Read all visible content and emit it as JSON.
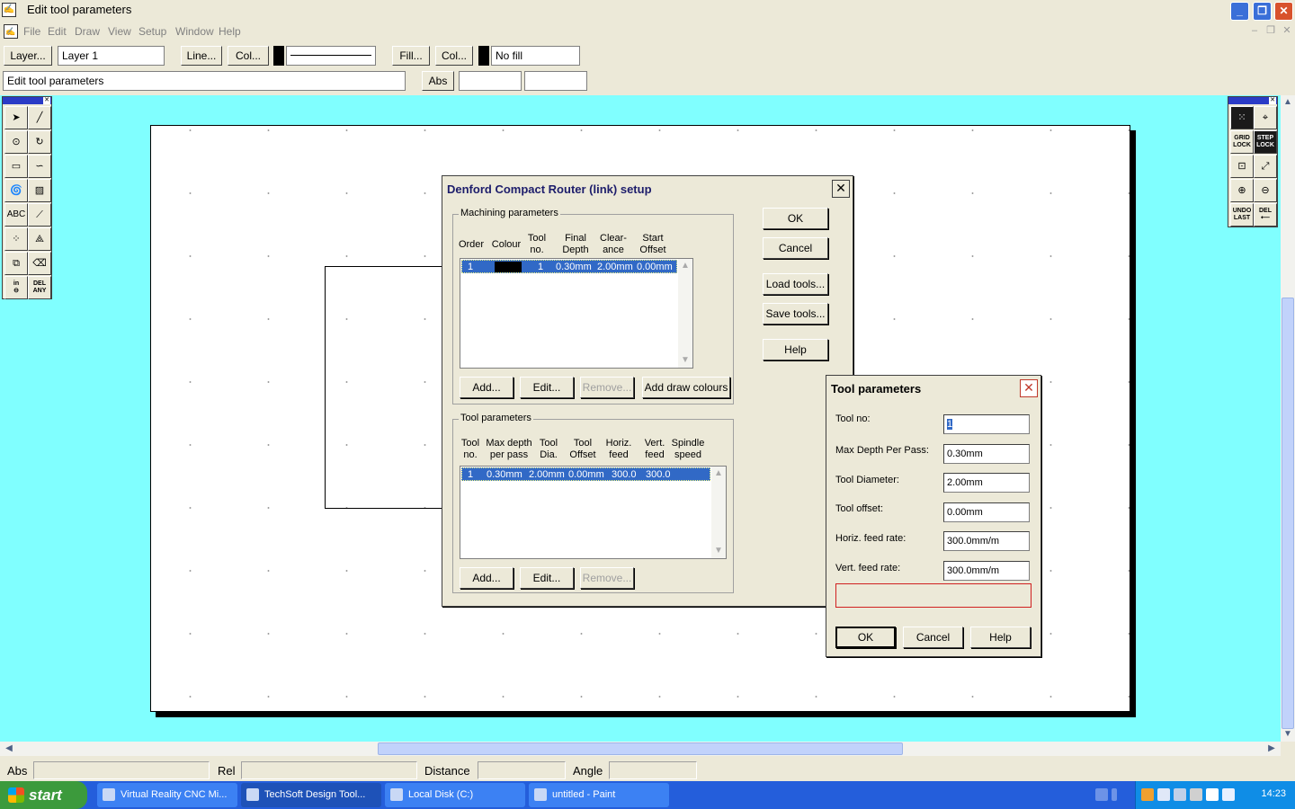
{
  "window": {
    "title": "Edit tool parameters",
    "app_icon_glyph": "✍"
  },
  "menu": [
    "File",
    "Edit",
    "Draw",
    "View",
    "Setup",
    "Window",
    "Help"
  ],
  "toolbar1": {
    "layer_button": "Layer...",
    "layer_value": "Layer 1",
    "line_button": "Line...",
    "line_colour_button": "Col...",
    "fill_button": "Fill...",
    "fill_colour_button": "Col...",
    "fill_value": "No fill"
  },
  "toolbar2": {
    "prompt_value": "Edit tool parameters",
    "abs_button": "Abs"
  },
  "palette_left": {
    "text_tool": "ABC",
    "in_tool": "in",
    "del_any": [
      "DEL",
      "ANY"
    ]
  },
  "palette_right": {
    "grid_lock": [
      "GRID",
      "LOCK"
    ],
    "step_lock": [
      "STEP",
      "LOCK"
    ],
    "undo_last": [
      "UNDO",
      "LAST"
    ],
    "del_tool": "DEL"
  },
  "router_dialog": {
    "title": "Denford Compact Router (link) setup",
    "machining_group": "Machining parameters",
    "machining_columns": [
      [
        "Order"
      ],
      [
        "Colour"
      ],
      [
        "Tool",
        "no."
      ],
      [
        "Final",
        "Depth"
      ],
      [
        "Clear-",
        "ance"
      ],
      [
        "Start",
        "Offset"
      ]
    ],
    "machining_rows": [
      {
        "order": "1",
        "colour": "#000000",
        "tool_no": "1",
        "final_depth": "0.30mm",
        "clearance": "2.00mm",
        "start_offset": "0.00mm"
      }
    ],
    "machining_buttons": {
      "add": "Add...",
      "edit": "Edit...",
      "remove": "Remove...",
      "add_draw_colours": "Add draw colours"
    },
    "tool_group": "Tool parameters",
    "tool_columns": [
      [
        "Tool",
        "no."
      ],
      [
        "Max depth",
        "per pass"
      ],
      [
        "Tool",
        "Dia."
      ],
      [
        "Tool",
        "Offset"
      ],
      [
        "Horiz.",
        "feed"
      ],
      [
        "Vert.",
        "feed"
      ],
      [
        "Spindle",
        "speed"
      ]
    ],
    "tool_rows": [
      {
        "tool_no": "1",
        "max_depth": "0.30mm",
        "dia": "2.00mm",
        "offset": "0.00mm",
        "horiz": "300.0",
        "vert": "300.0",
        "spindle": ""
      }
    ],
    "tool_buttons": {
      "add": "Add...",
      "edit": "Edit...",
      "remove": "Remove..."
    },
    "side_buttons": {
      "ok": "OK",
      "cancel": "Cancel",
      "load": "Load tools...",
      "save": "Save tools...",
      "help": "Help"
    }
  },
  "tool_dialog": {
    "title": "Tool parameters",
    "fields": [
      {
        "label": "Tool no:",
        "value": "1"
      },
      {
        "label": "Max Depth Per Pass:",
        "value": "0.30mm"
      },
      {
        "label": "Tool Diameter:",
        "value": "2.00mm"
      },
      {
        "label": "Tool offset:",
        "value": "0.00mm"
      },
      {
        "label": "Horiz. feed rate:",
        "value": "300.0mm/m"
      },
      {
        "label": "Vert. feed rate:",
        "value": "300.0mm/m"
      }
    ],
    "buttons": {
      "ok": "OK",
      "cancel": "Cancel",
      "help": "Help"
    }
  },
  "statusbar": {
    "abs": "Abs",
    "rel": "Rel",
    "distance": "Distance",
    "angle": "Angle"
  },
  "taskbar": {
    "start": "start",
    "tasks": [
      "Virtual Reality CNC Mi...",
      "TechSoft Design Tool...",
      "Local Disk (C:)",
      "untitled - Paint"
    ],
    "clock": "14:23"
  },
  "colors": {
    "workspace": "#80ffff",
    "selection": "#3169c6",
    "taskbar": "#245edb",
    "start": "#3c9a3c"
  }
}
